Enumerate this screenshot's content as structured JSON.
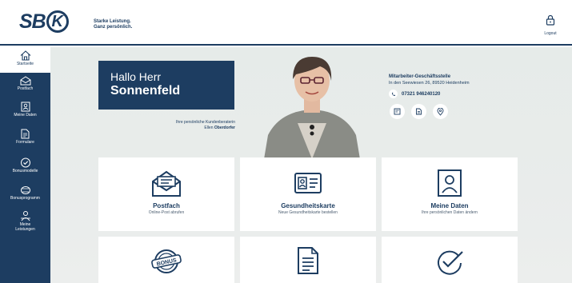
{
  "brand": {
    "logo_text": "SBK",
    "tagline_line1": "Starke Leistung.",
    "tagline_line2": "Ganz persönlich."
  },
  "header": {
    "logout_label": "Logout"
  },
  "sidebar": {
    "items": [
      {
        "label": "Startseite",
        "icon": "home-icon",
        "active": true
      },
      {
        "label": "Postfach",
        "icon": "mailbox-icon",
        "active": false
      },
      {
        "label": "Meine Daten",
        "icon": "id-card-icon",
        "active": false
      },
      {
        "label": "Formulare",
        "icon": "document-icon",
        "active": false
      },
      {
        "label": "Bonusmodelle",
        "icon": "bonus-icon",
        "active": false
      },
      {
        "label": "Bonusprogramm",
        "icon": "piggy-icon",
        "active": false
      },
      {
        "label": "Meine",
        "label2": "Leistungen",
        "icon": "person-benefits-icon",
        "active": false
      }
    ]
  },
  "greeting": {
    "line1": "Hallo Herr",
    "line2": "Sonnenfeld",
    "advisor_caption": "Ihre persönliche Kundenberaterin",
    "advisor_name_first": "Ellen",
    "advisor_name_last": "Oberdorfer"
  },
  "office": {
    "title": "Mitarbeiter-Geschäftsstelle",
    "address": "In den Seewiesen 26, 89520 Heidenheim",
    "phone": "07321 946240120"
  },
  "tiles": [
    {
      "title": "Postfach",
      "subtitle": "Online-Post abrufen",
      "icon": "envelope-icon"
    },
    {
      "title": "Gesundheitskarte",
      "subtitle": "Neue Gesundheitskarte bestellen",
      "icon": "health-card-icon"
    },
    {
      "title": "Meine Daten",
      "subtitle": "Ihre persönlichen Daten ändern",
      "icon": "profile-icon"
    },
    {
      "title": "",
      "subtitle": "",
      "icon": "bonus-badge-icon",
      "badge_text": "BONUS"
    },
    {
      "title": "",
      "subtitle": "",
      "icon": "form-document-icon"
    },
    {
      "title": "",
      "subtitle": "",
      "icon": "check-badge-icon"
    }
  ],
  "colors": {
    "primary": "#1d3d61",
    "hero_background": "#e8ecea",
    "tile_background": "#ffffff"
  }
}
